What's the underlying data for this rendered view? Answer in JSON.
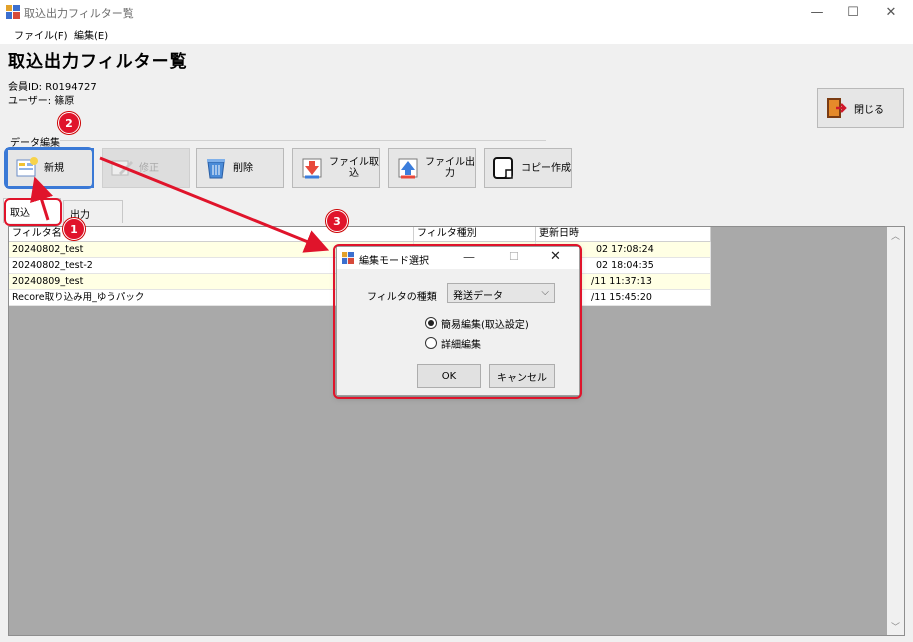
{
  "window": {
    "title": "取込出力フィルター覧",
    "minimize": "—",
    "maximize": "☐",
    "close": "✕"
  },
  "menu": {
    "file": "ファイル(F)",
    "edit": "編集(E)"
  },
  "page": {
    "title": "取込出力フィルター覧",
    "member_id": "会員ID: R0194727",
    "user": "ユーザー: 篠原"
  },
  "toolbar": {
    "group_label": "データ編集",
    "new": "新規",
    "modify": "修正",
    "delete": "削除",
    "import_line1": "ファイル取",
    "import_line2": "込",
    "export_line1": "ファイル出",
    "export_line2": "力",
    "copy": "コピー作成",
    "close": "閉じる"
  },
  "tabs": [
    "取込",
    "出力"
  ],
  "grid": {
    "columns": [
      "フィルタ名",
      "フィルタ種別",
      "更新日時"
    ],
    "rows": [
      {
        "name": "20240802_test",
        "type": "",
        "updated": "2024/08/02 17:08:24"
      },
      {
        "name": "20240802_test-2",
        "type": "",
        "updated": "2024/08/02 18:04:35"
      },
      {
        "name": "20240809_test",
        "type": "",
        "updated": "2024/09/11 11:37:13"
      },
      {
        "name": "Recore取り込み用_ゆうパック",
        "type": "",
        "updated": "2024/09/11 15:45:20"
      }
    ],
    "visible_updated": [
      "02 17:08:24",
      "02 18:04:35",
      "/11 11:37:13",
      "/11 15:45:20"
    ]
  },
  "dialog": {
    "title": "編集モード選択",
    "filter_type_label": "フィルタの種類",
    "filter_type_value": "発送データ",
    "option_simple": "簡易編集(取込設定)",
    "option_detail": "詳細編集",
    "ok": "OK",
    "cancel": "キャンセル"
  },
  "annotations": {
    "badge1": "1",
    "badge2": "2",
    "badge3": "3",
    "color": "#e0142b"
  }
}
